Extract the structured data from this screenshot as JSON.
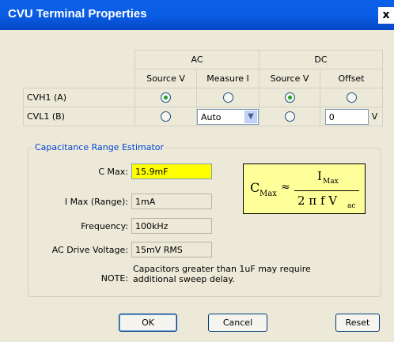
{
  "window": {
    "title": "CVU Terminal Properties",
    "close_glyph": "x"
  },
  "grid": {
    "groups": {
      "ac": "AC",
      "dc": "DC"
    },
    "columns": [
      "Source V",
      "Measure I",
      "Source V",
      "Offset"
    ],
    "rows": [
      {
        "label": "CVH1 (A)",
        "ac_source_v": true,
        "measure_i": false,
        "dc_source_v": true,
        "offset": false
      },
      {
        "label": "CVL1 (B)",
        "ac_source_v": false,
        "measure_i_select": "Auto",
        "dc_source_v": false,
        "offset_value": "0",
        "offset_unit": "V"
      }
    ]
  },
  "estimator": {
    "title": "Capacitance Range Estimator",
    "fields": [
      {
        "label": "C Max:",
        "value": "15.9mF"
      },
      {
        "label": "I Max (Range):",
        "value": "1mA"
      },
      {
        "label": "Frequency:",
        "value": "100kHz"
      },
      {
        "label": "AC Drive Voltage:",
        "value": "15mV RMS"
      }
    ],
    "formula": {
      "lhs": "C",
      "lhs_sub": "Max",
      "approx": "≈",
      "num": "I",
      "num_sub": "Max",
      "den": "2 π f V",
      "den_sub": "ac"
    },
    "note_label": "NOTE:",
    "note_text": "Capacitors greater than 1uF may require additional sweep delay."
  },
  "buttons": {
    "ok": "OK",
    "cancel": "Cancel",
    "reset": "Reset"
  },
  "colors": {
    "title_bar": "#0a5fe6",
    "highlight": "#ffff00",
    "formula_bg": "#ffff99",
    "group_title": "#0046d5"
  }
}
